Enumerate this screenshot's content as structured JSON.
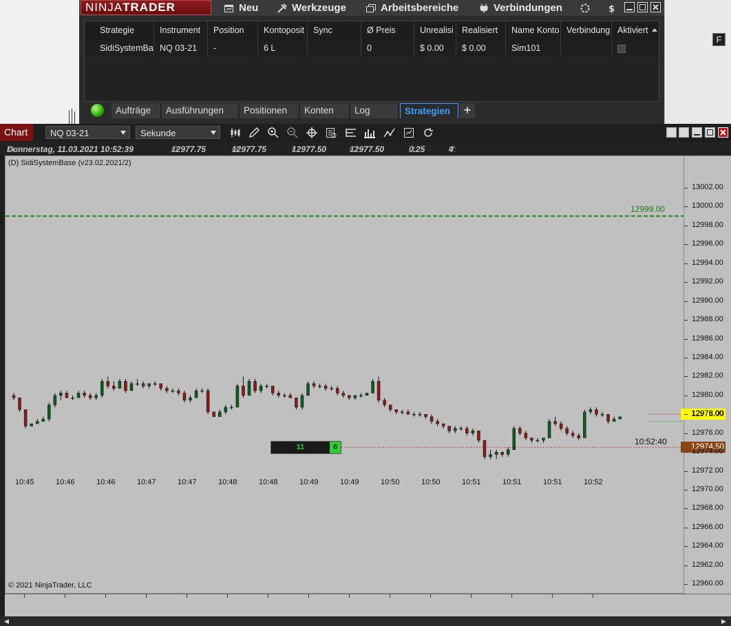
{
  "menubar": {
    "logo_thin": "NINJA",
    "logo_bold": "TRADER",
    "items": [
      {
        "label": "Neu",
        "icon": "new-window-icon"
      },
      {
        "label": "Werkzeuge",
        "icon": "tools-icon"
      },
      {
        "label": "Arbeitsbereiche",
        "icon": "workspaces-icon"
      },
      {
        "label": "Verbindungen",
        "icon": "plug-icon"
      }
    ]
  },
  "grid": {
    "columns": [
      "Strategie",
      "Instrument",
      "Position",
      "Kontoposit",
      "Sync",
      "Ø Preis",
      "Unrealisi",
      "Realisiert",
      "Name Konto",
      "Verbindung",
      "Aktiviert"
    ],
    "row": [
      "SidiSystemBa",
      "NQ 03-21",
      "-",
      "6 L",
      "",
      "0",
      "$ 0.00",
      "$ 0.00",
      "Sim101",
      "",
      ""
    ]
  },
  "tabs": [
    "Aufträge",
    "Ausführungen",
    "Positionen",
    "Konten",
    "Log",
    "Strategien"
  ],
  "tab_add": "+",
  "chart": {
    "title": "Chart",
    "instrument": "NQ 03-21",
    "period": "Sekunde",
    "info": {
      "time_label": "Time:",
      "time": "Donnerstag, 11.03.2021 10:52:39",
      "open_label": "O:",
      "open": "12977.75",
      "high_label": "H:",
      "high": "12977.75",
      "low_label": "L:",
      "low": "12977.50",
      "close_label": "C:",
      "close": "12977.50",
      "range_label": "R:",
      "range": "0.25",
      "volume_label": "V:",
      "volume": "4"
    },
    "strategy_label": "(D) SidiSystemBase (v23.02.2021/2)",
    "f_button": "F",
    "copyright": "© 2021 NinjaTrader, LLC",
    "target_line_label": "12999.00",
    "order_box": {
      "left": "11",
      "right": "6"
    },
    "time_label": "10:52:40",
    "last_price": "12978.00",
    "entry_price": "12974.50",
    "y_ticks": [
      "13002.00",
      "13000.00",
      "12998.00",
      "12996.00",
      "12994.00",
      "12992.00",
      "12990.00",
      "12988.00",
      "12986.00",
      "12984.00",
      "12982.00",
      "12980.00",
      "12978.00",
      "12976.00",
      "12974.00",
      "12972.00",
      "12970.00",
      "12968.00",
      "12966.00",
      "12964.00",
      "12962.00",
      "12960.00"
    ],
    "x_ticks": [
      "10:45",
      "10:46",
      "10:46",
      "10:47",
      "10:47",
      "10:48",
      "10:48",
      "10:49",
      "10:49",
      "10:50",
      "10:50",
      "10:51",
      "10:51",
      "10:51",
      "10:52"
    ],
    "colors": {
      "up": "#0f5a22",
      "down": "#8a1b1b",
      "target": "#1a8a1a",
      "last_tag": "#ffff00",
      "entry_tag": "#8b4513"
    },
    "candles": [
      [
        12980.0,
        12980.25,
        12979.5,
        12979.75
      ],
      [
        12979.75,
        12979.75,
        12978.25,
        12978.5
      ],
      [
        12978.5,
        12978.5,
        12976.5,
        12976.75
      ],
      [
        12976.75,
        12977.0,
        12976.75,
        12977.0
      ],
      [
        12977.0,
        12977.5,
        12977.0,
        12977.25
      ],
      [
        12977.25,
        12977.75,
        12977.25,
        12977.5
      ],
      [
        12977.5,
        12979.25,
        12977.25,
        12979.0
      ],
      [
        12979.0,
        12980.25,
        12978.75,
        12980.0
      ],
      [
        12980.0,
        12980.5,
        12979.5,
        12980.25
      ],
      [
        12980.25,
        12980.5,
        12979.75,
        12979.75
      ],
      [
        12979.75,
        12980.0,
        12979.5,
        12979.75
      ],
      [
        12979.75,
        12980.5,
        12979.75,
        12980.25
      ],
      [
        12980.25,
        12980.5,
        12979.75,
        12980.0
      ],
      [
        12980.0,
        12980.25,
        12979.5,
        12979.75
      ],
      [
        12979.75,
        12980.25,
        12979.5,
        12980.0
      ],
      [
        12980.0,
        12981.75,
        12979.75,
        12981.5
      ],
      [
        12981.5,
        12982.0,
        12980.75,
        12981.0
      ],
      [
        12981.0,
        12981.5,
        12980.5,
        12980.75
      ],
      [
        12980.75,
        12981.75,
        12980.75,
        12981.5
      ],
      [
        12981.5,
        12981.75,
        12980.25,
        12980.5
      ],
      [
        12980.5,
        12981.5,
        12980.5,
        12981.25
      ],
      [
        12981.25,
        12981.75,
        12981.0,
        12981.25
      ],
      [
        12981.25,
        12981.5,
        12980.75,
        12981.0
      ],
      [
        12981.0,
        12981.25,
        12980.75,
        12981.25
      ],
      [
        12981.25,
        12981.5,
        12981.0,
        12981.25
      ],
      [
        12981.25,
        12981.25,
        12980.5,
        12980.75
      ],
      [
        12980.75,
        12981.0,
        12980.25,
        12980.5
      ],
      [
        12980.5,
        12980.75,
        12980.25,
        12980.5
      ],
      [
        12980.5,
        12980.75,
        12980.0,
        12980.25
      ],
      [
        12980.25,
        12980.5,
        12979.25,
        12979.5
      ],
      [
        12979.5,
        12980.0,
        12979.25,
        12979.75
      ],
      [
        12979.75,
        12980.75,
        12979.75,
        12980.5
      ],
      [
        12980.5,
        12980.75,
        12980.25,
        12980.5
      ],
      [
        12980.5,
        12980.75,
        12978.0,
        12978.25
      ],
      [
        12978.25,
        12978.25,
        12977.75,
        12977.75
      ],
      [
        12977.75,
        12978.5,
        12977.75,
        12978.25
      ],
      [
        12978.25,
        12979.0,
        12978.0,
        12978.75
      ],
      [
        12978.75,
        12979.0,
        12978.5,
        12978.75
      ],
      [
        12978.75,
        12981.25,
        12978.75,
        12981.0
      ],
      [
        12981.0,
        12982.0,
        12979.75,
        12980.0
      ],
      [
        12980.0,
        12981.75,
        12980.0,
        12981.5
      ],
      [
        12981.5,
        12981.75,
        12980.25,
        12980.5
      ],
      [
        12980.5,
        12981.25,
        12980.25,
        12981.0
      ],
      [
        12981.0,
        12981.25,
        12980.75,
        12981.0
      ],
      [
        12981.0,
        12981.0,
        12980.0,
        12980.25
      ],
      [
        12980.25,
        12980.5,
        12979.75,
        12980.0
      ],
      [
        12980.0,
        12980.25,
        12979.75,
        12980.0
      ],
      [
        12980.0,
        12980.25,
        12979.75,
        12979.75
      ],
      [
        12979.75,
        12979.75,
        12978.5,
        12978.75
      ],
      [
        12978.75,
        12980.25,
        12978.5,
        12980.0
      ],
      [
        12980.0,
        12981.5,
        12980.0,
        12981.25
      ],
      [
        12981.25,
        12981.5,
        12980.75,
        12981.0
      ],
      [
        12981.0,
        12981.25,
        12980.75,
        12981.0
      ],
      [
        12981.0,
        12981.25,
        12980.5,
        12980.75
      ],
      [
        12980.75,
        12981.0,
        12980.5,
        12980.75
      ],
      [
        12980.75,
        12981.0,
        12980.0,
        12980.25
      ],
      [
        12980.25,
        12980.5,
        12979.75,
        12980.0
      ],
      [
        12980.0,
        12980.0,
        12979.5,
        12979.75
      ],
      [
        12979.75,
        12980.0,
        12979.5,
        12980.0
      ],
      [
        12980.0,
        12980.25,
        12979.75,
        12980.0
      ],
      [
        12980.0,
        12980.25,
        12980.0,
        12980.25
      ],
      [
        12980.25,
        12981.75,
        12980.25,
        12981.5
      ],
      [
        12981.5,
        12982.0,
        12979.25,
        12979.5
      ],
      [
        12979.5,
        12979.75,
        12978.75,
        12979.0
      ],
      [
        12979.0,
        12979.0,
        12978.25,
        12978.5
      ],
      [
        12978.5,
        12978.5,
        12978.0,
        12978.25
      ],
      [
        12978.25,
        12978.5,
        12978.0,
        12978.25
      ],
      [
        12978.25,
        12978.5,
        12978.0,
        12978.0
      ],
      [
        12978.0,
        12978.25,
        12977.75,
        12978.0
      ],
      [
        12978.0,
        12978.25,
        12977.75,
        12978.0
      ],
      [
        12978.0,
        12978.0,
        12977.5,
        12977.75
      ],
      [
        12977.75,
        12978.0,
        12977.0,
        12977.25
      ],
      [
        12977.25,
        12977.5,
        12976.75,
        12977.0
      ],
      [
        12977.0,
        12977.0,
        12976.5,
        12976.75
      ],
      [
        12976.75,
        12976.75,
        12976.0,
        12976.25
      ],
      [
        12976.25,
        12976.75,
        12976.0,
        12976.5
      ],
      [
        12976.5,
        12976.75,
        12976.25,
        12976.5
      ],
      [
        12976.5,
        12976.75,
        12975.75,
        12976.0
      ],
      [
        12976.0,
        12976.5,
        12975.75,
        12976.25
      ],
      [
        12976.25,
        12976.25,
        12975.0,
        12975.25
      ],
      [
        12975.25,
        12975.25,
        12973.25,
        12973.5
      ],
      [
        12973.5,
        12974.25,
        12973.25,
        12973.75
      ],
      [
        12973.75,
        12974.25,
        12973.25,
        12974.0
      ],
      [
        12974.0,
        12974.0,
        12973.5,
        12973.75
      ],
      [
        12973.75,
        12974.5,
        12973.5,
        12974.25
      ],
      [
        12974.25,
        12976.75,
        12974.25,
        12976.5
      ],
      [
        12976.5,
        12976.75,
        12975.75,
        12976.0
      ],
      [
        12976.0,
        12976.25,
        12975.25,
        12975.5
      ],
      [
        12975.5,
        12975.5,
        12975.0,
        12975.25
      ],
      [
        12975.25,
        12975.5,
        12975.0,
        12975.25
      ],
      [
        12975.25,
        12975.5,
        12975.0,
        12975.5
      ],
      [
        12975.5,
        12977.5,
        12975.5,
        12977.25
      ],
      [
        12977.25,
        12977.75,
        12976.75,
        12977.0
      ],
      [
        12977.0,
        12977.25,
        12976.25,
        12976.5
      ],
      [
        12976.5,
        12976.75,
        12975.75,
        12976.0
      ],
      [
        12976.0,
        12976.25,
        12975.5,
        12975.75
      ],
      [
        12975.75,
        12976.0,
        12975.25,
        12975.5
      ],
      [
        12975.5,
        12978.5,
        12975.5,
        12978.25
      ],
      [
        12978.25,
        12978.75,
        12978.0,
        12978.5
      ],
      [
        12978.5,
        12978.75,
        12977.75,
        12978.0
      ],
      [
        12978.0,
        12978.25,
        12977.75,
        12978.0
      ],
      [
        12978.0,
        12978.0,
        12977.0,
        12977.25
      ],
      [
        12977.25,
        12977.75,
        12977.25,
        12977.5
      ],
      [
        12977.5,
        12977.75,
        12977.5,
        12977.75
      ]
    ]
  }
}
